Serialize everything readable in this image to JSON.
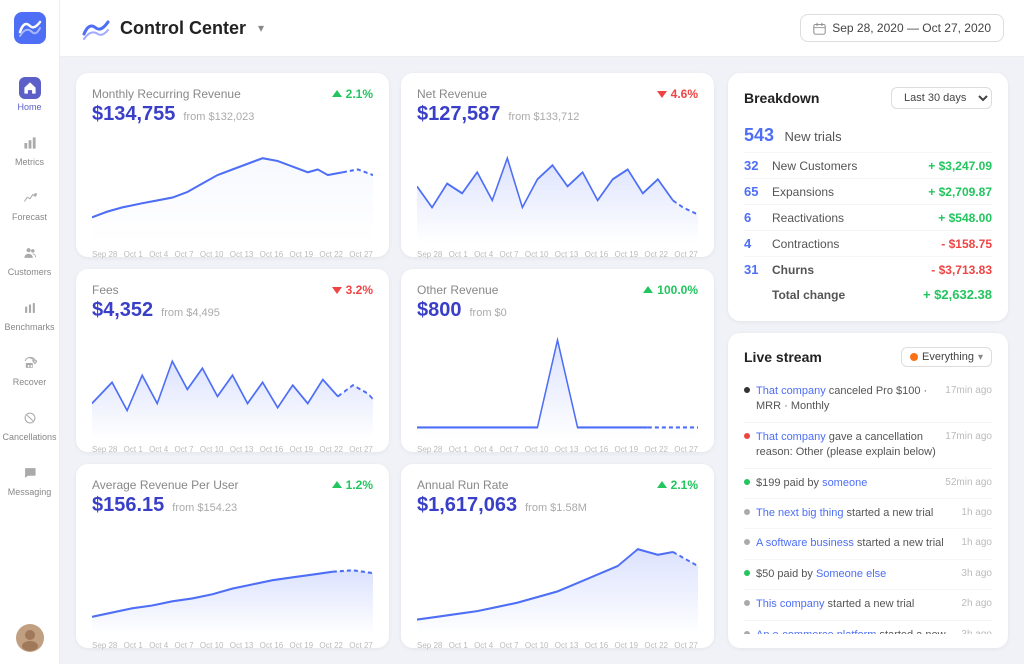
{
  "sidebar": {
    "logo_alt": "Baremetrics logo",
    "items": [
      {
        "id": "home",
        "label": "Home",
        "active": true
      },
      {
        "id": "metrics",
        "label": "Metrics",
        "active": false
      },
      {
        "id": "forecast",
        "label": "Forecast",
        "active": false
      },
      {
        "id": "customers",
        "label": "Customers",
        "active": false
      },
      {
        "id": "benchmarks",
        "label": "Benchmarks",
        "active": false
      },
      {
        "id": "recover",
        "label": "Recover",
        "active": false
      },
      {
        "id": "cancellations",
        "label": "Cancellations",
        "active": false
      },
      {
        "id": "messaging",
        "label": "Messaging",
        "active": false
      }
    ]
  },
  "topbar": {
    "title": "Control Center",
    "date_range": "Sep 28, 2020 — Oct 27, 2020"
  },
  "charts": {
    "monthly_recurring_revenue": {
      "title": "Monthly Recurring Revenue",
      "value": "$134,755",
      "from": "from $132,023",
      "change": "2.1%",
      "change_dir": "up"
    },
    "net_revenue": {
      "title": "Net Revenue",
      "value": "$127,587",
      "from": "from $133,712",
      "change": "4.6%",
      "change_dir": "down"
    },
    "fees": {
      "title": "Fees",
      "value": "$4,352",
      "from": "from $4,495",
      "change": "3.2%",
      "change_dir": "down"
    },
    "other_revenue": {
      "title": "Other Revenue",
      "value": "$800",
      "from": "from $0",
      "change": "100.0%",
      "change_dir": "up"
    },
    "arpu": {
      "title": "Average Revenue Per User",
      "value": "$156.15",
      "from": "from $154.23",
      "change": "1.2%",
      "change_dir": "up"
    },
    "arr": {
      "title": "Annual Run Rate",
      "value": "$1,617,063",
      "from": "from $1.58M",
      "change": "2.1%",
      "change_dir": "up"
    }
  },
  "breakdown": {
    "title": "Breakdown",
    "period_label": "Last 30 days",
    "new_trials": {
      "num": "543",
      "label": "New trials"
    },
    "rows": [
      {
        "num": "32",
        "label": "New Customers",
        "amount": "+ $3,247.09",
        "type": "pos"
      },
      {
        "num": "65",
        "label": "Expansions",
        "amount": "+ $2,709.87",
        "type": "pos"
      },
      {
        "num": "6",
        "label": "Reactivations",
        "amount": "+ $548.00",
        "type": "pos"
      },
      {
        "num": "4",
        "label": "Contractions",
        "amount": "- $158.75",
        "type": "neg"
      },
      {
        "num": "31",
        "label": "Churns",
        "amount": "- $3,713.83",
        "type": "neg"
      }
    ],
    "total_label": "Total change",
    "total_amount": "+ $2,632.38"
  },
  "livestream": {
    "title": "Live stream",
    "filter": "Everything",
    "events": [
      {
        "type": "black",
        "text_parts": [
          {
            "link": "That company",
            "link_href": true
          },
          " canceled Pro $100 · MRR · Monthly"
        ],
        "time": "17min ago"
      },
      {
        "type": "red",
        "text_parts": [
          {
            "link": "That company",
            "link_href": true
          },
          " gave a cancellation reason: Other (please explain below)"
        ],
        "time": "17min ago"
      },
      {
        "type": "green",
        "text_parts": [
          "$199 paid by ",
          {
            "link": "someone",
            "link_href": true
          }
        ],
        "time": "52min ago"
      },
      {
        "type": "gray",
        "text_parts": [
          {
            "link": "The next big thing",
            "link_href": true
          },
          " started a new trial"
        ],
        "time": "1h ago"
      },
      {
        "type": "gray",
        "text_parts": [
          {
            "link": "A software business",
            "link_href": true
          },
          " started a new trial"
        ],
        "time": "1h ago"
      },
      {
        "type": "green",
        "text_parts": [
          "$50 paid by ",
          {
            "link": "Someone else",
            "link_href": true
          }
        ],
        "time": "3h ago"
      },
      {
        "type": "gray",
        "text_parts": [
          {
            "link": "This company",
            "link_href": true
          },
          " started a new trial"
        ],
        "time": "2h ago"
      },
      {
        "type": "gray",
        "text_parts": [
          {
            "link": "An e-commerce platform",
            "link_href": true
          },
          " started a new trial"
        ],
        "time": "3h ago"
      }
    ]
  }
}
